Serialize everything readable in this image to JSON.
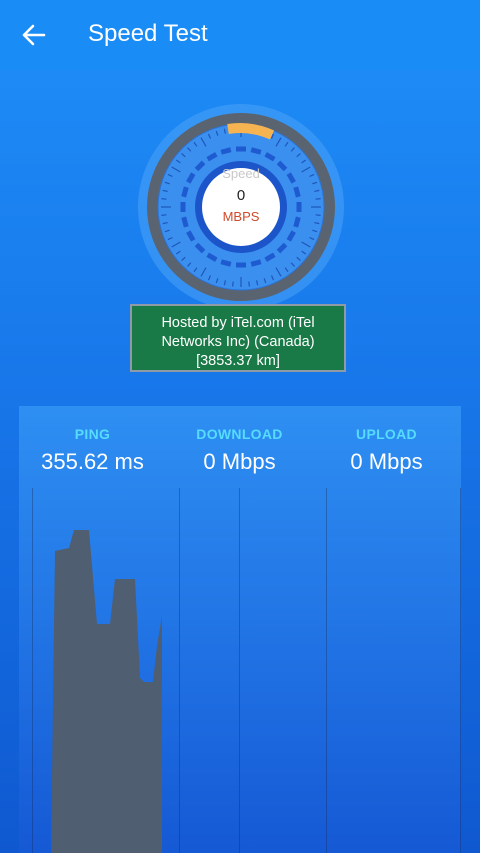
{
  "header": {
    "title": "Speed Test",
    "back_icon": "arrow-left-icon"
  },
  "gauge": {
    "label": "Speed",
    "value": "0",
    "unit": "MBPS"
  },
  "server": {
    "line1": "Hosted by iTel.com (iTel",
    "line2": "Networks Inc) (Canada)",
    "line3": "[3853.37 km]"
  },
  "results": {
    "ping": {
      "label": "PING",
      "value": "355.62 ms"
    },
    "download": {
      "label": "DOWNLOAD",
      "value": "0 Mbps"
    },
    "upload": {
      "label": "UPLOAD",
      "value": "0 Mbps"
    }
  },
  "colors": {
    "background": "#1a8cf6",
    "server_box": "#1a7a47",
    "label_accent": "#55dcff",
    "unit_accent": "#d04a2a",
    "graph_fill": "#4f5e70"
  }
}
